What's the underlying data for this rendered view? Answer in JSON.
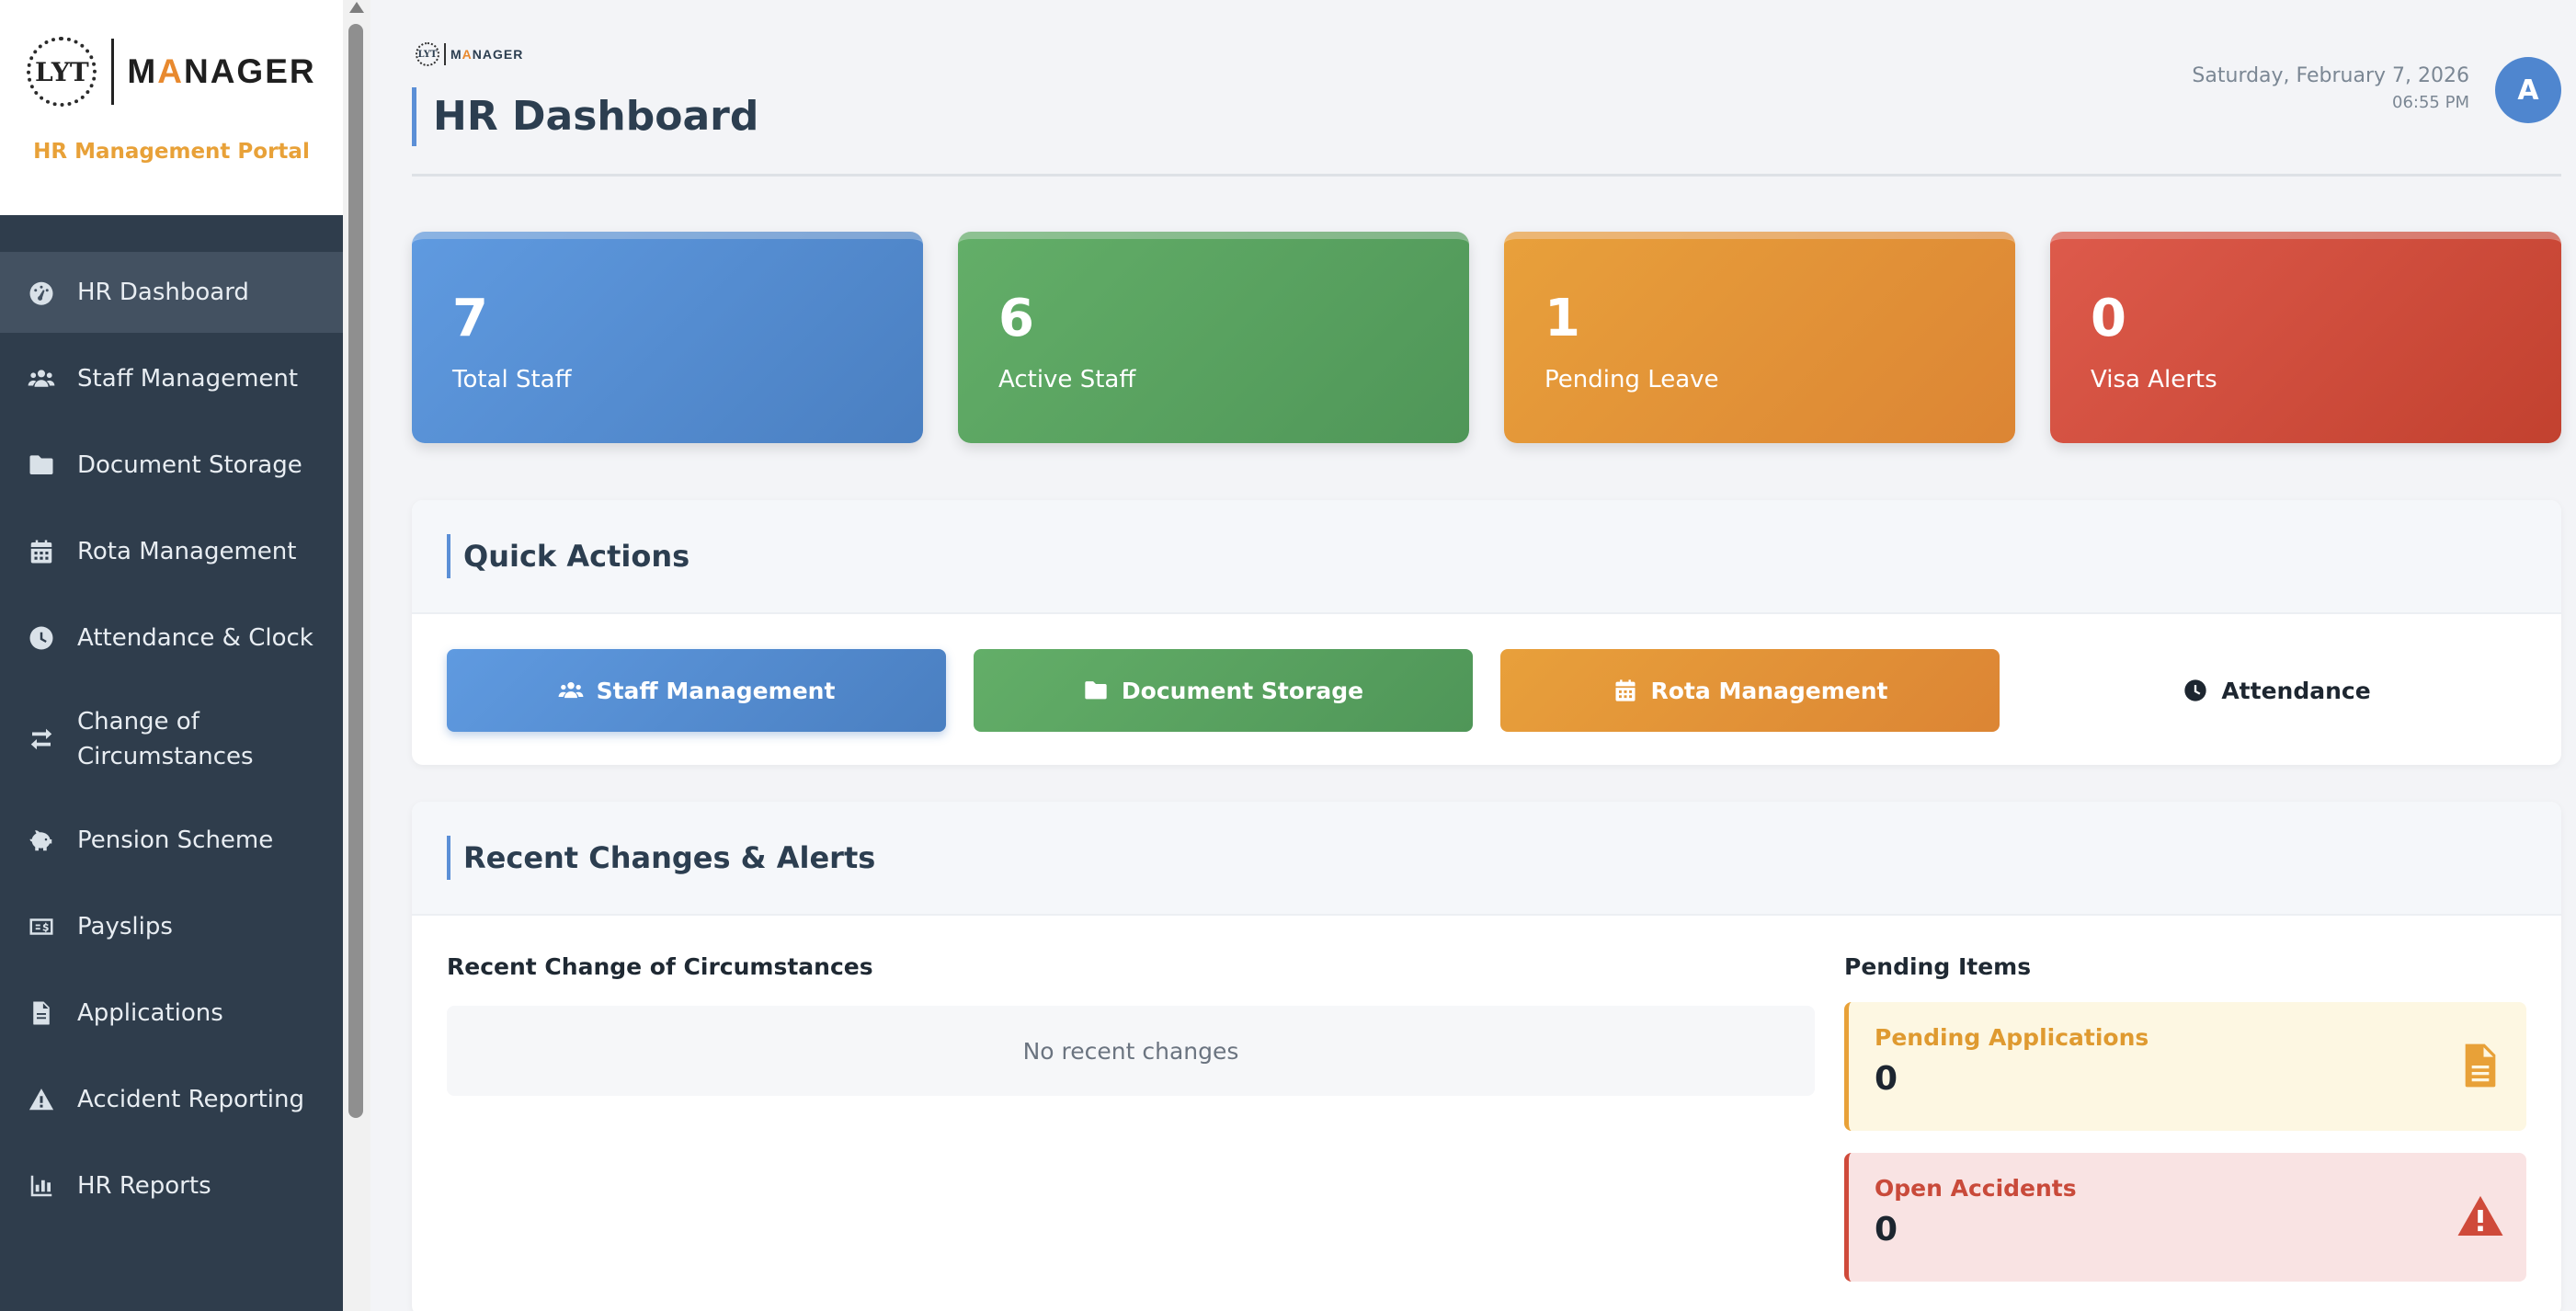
{
  "sidebar": {
    "logo": {
      "mark": "LYT",
      "word_prefix": "M",
      "word_accent": "A",
      "word_suffix": "NAGER"
    },
    "portal_title": "HR Management Portal",
    "items": [
      {
        "label": "HR Dashboard",
        "icon": "dashboard-icon",
        "active": true
      },
      {
        "label": "Staff Management",
        "icon": "users-icon"
      },
      {
        "label": "Document Storage",
        "icon": "folder-icon"
      },
      {
        "label": "Rota Management",
        "icon": "calendar-icon"
      },
      {
        "label": "Attendance & Clock",
        "icon": "clock-icon"
      },
      {
        "label": "Change of Circumstances",
        "icon": "exchange-icon"
      },
      {
        "label": "Pension Scheme",
        "icon": "piggy-bank-icon"
      },
      {
        "label": "Payslips",
        "icon": "money-bill-icon"
      },
      {
        "label": "Applications",
        "icon": "file-icon"
      },
      {
        "label": "Accident Reporting",
        "icon": "warning-icon"
      },
      {
        "label": "HR Reports",
        "icon": "bar-chart-icon"
      }
    ]
  },
  "header": {
    "mini_logo": {
      "mark": "LYT",
      "word_prefix": "M",
      "word_accent": "A",
      "word_suffix": "NAGER"
    },
    "title": "HR Dashboard",
    "date": "Saturday, February 7, 2026",
    "time": "06:55 PM",
    "avatar_initial": "A"
  },
  "stats": [
    {
      "value": "7",
      "label": "Total Staff",
      "color": "#5a92d9"
    },
    {
      "value": "6",
      "label": "Active Staff",
      "color": "#5aa361"
    },
    {
      "value": "1",
      "label": "Pending Leave",
      "color": "#e3953a"
    },
    {
      "value": "0",
      "label": "Visa Alerts",
      "color": "#d24f3f"
    }
  ],
  "quick_actions": {
    "title": "Quick Actions",
    "buttons": [
      {
        "label": "Staff Management",
        "icon": "users-icon"
      },
      {
        "label": "Document Storage",
        "icon": "folder-icon"
      },
      {
        "label": "Rota Management",
        "icon": "calendar-icon"
      },
      {
        "label": "Attendance",
        "icon": "clock-icon"
      }
    ]
  },
  "recent": {
    "title": "Recent Changes & Alerts",
    "changes_title": "Recent Change of Circumstances",
    "empty_text": "No recent changes",
    "pending_title": "Pending Items",
    "pending": [
      {
        "label": "Pending Applications",
        "count": "0",
        "icon": "file-alt-icon",
        "color": "#e8a138"
      },
      {
        "label": "Open Accidents",
        "count": "0",
        "icon": "exclamation-triangle-icon",
        "color": "#cf4a3a"
      }
    ]
  }
}
